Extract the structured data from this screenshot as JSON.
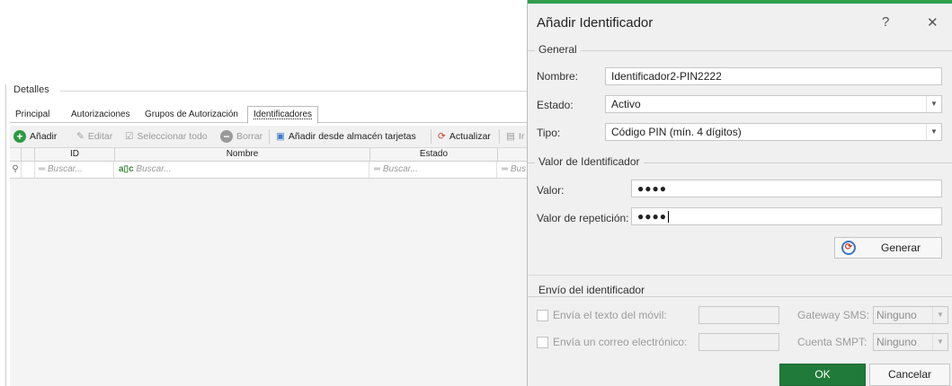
{
  "background": {
    "group_title": "Detalles",
    "tabs": [
      {
        "label": "Principal"
      },
      {
        "label": "Autorizaciones"
      },
      {
        "label": "Grupos de Autorización"
      },
      {
        "label": "Identificadores"
      }
    ],
    "toolbar": {
      "add": "Añadir",
      "edit": "Editar",
      "select_all": "Seleccionar todo",
      "delete": "Borrar",
      "add_from_store": "Añadir desde almacén tarjetas",
      "refresh": "Actualizar",
      "truncated": "Ir"
    },
    "grid": {
      "columns": [
        "ID",
        "Nombre",
        "Estado"
      ],
      "filter_placeholder": "Buscar...",
      "filter_truncated": "Bus"
    }
  },
  "dialog": {
    "title": "Añadir Identificador",
    "help_glyph": "?",
    "close_glyph": "✕",
    "general": {
      "caption": "General",
      "name_label": "Nombre:",
      "name_value": "Identificador2-PIN2222",
      "status_label": "Estado:",
      "status_value": "Activo",
      "type_label": "Tipo:",
      "type_value": "Código PIN (mín. 4 dígitos)"
    },
    "value_section": {
      "caption": "Valor de Identificador",
      "value_label": "Valor:",
      "value_mask": "●●●●",
      "repeat_label": "Valor de repetición:",
      "repeat_mask": "●●●●",
      "generate_label": "Generar"
    },
    "send_section": {
      "caption": "Envío del identificador",
      "sms_text_label": "Envía el texto del móvil:",
      "email_label": "Envía un correo electrónico:",
      "gateway_label": "Gateway SMS:",
      "gateway_value": "Ninguno",
      "smtp_label": "Cuenta SMPT:",
      "smtp_value": "Ninguno"
    },
    "ok_label": "OK",
    "cancel_label": "Cancelar"
  },
  "colors": {
    "accent_green": "#207a3a",
    "top_accent": "#2f9e4f"
  }
}
